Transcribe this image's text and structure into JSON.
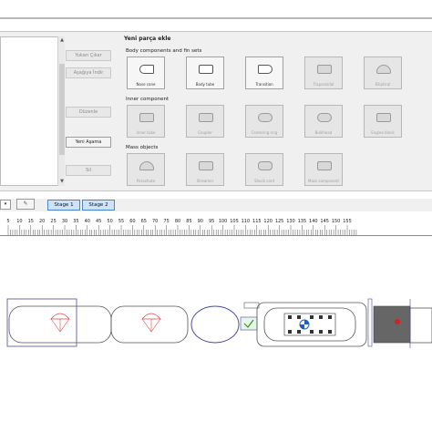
{
  "side_buttons": [
    {
      "label": "Yukarı Çıkar",
      "active": false
    },
    {
      "label": "Aşağıya İndir",
      "active": false
    },
    {
      "label": "Düzenle",
      "active": false
    },
    {
      "label": "Yeni Aşama",
      "active": true
    },
    {
      "label": "Sil",
      "active": false
    }
  ],
  "parts_panel": {
    "title": "Yeni parça ekle",
    "sections": [
      {
        "label": "Body components and fin sets",
        "tiles": [
          {
            "label": "Nose cone",
            "icon": "nose-cone-icon",
            "enabled": true
          },
          {
            "label": "Body tube",
            "icon": "body-tube-icon",
            "enabled": true
          },
          {
            "label": "Transition",
            "icon": "transition-icon",
            "enabled": true
          },
          {
            "label": "Trapezoidal",
            "icon": "trapezoidal-fin-icon",
            "enabled": false
          },
          {
            "label": "Elliptical",
            "icon": "elliptical-fin-icon",
            "enabled": false
          }
        ]
      },
      {
        "label": "Inner component",
        "tiles": [
          {
            "label": "Inner tube",
            "icon": "inner-tube-icon",
            "enabled": false
          },
          {
            "label": "Coupler",
            "icon": "coupler-icon",
            "enabled": false
          },
          {
            "label": "Centering ring",
            "icon": "centering-ring-icon",
            "enabled": false
          },
          {
            "label": "Bulkhead",
            "icon": "bulkhead-icon",
            "enabled": false
          },
          {
            "label": "Engine block",
            "icon": "engine-block-icon",
            "enabled": false
          }
        ]
      },
      {
        "label": "Mass objects",
        "tiles": [
          {
            "label": "Parachute",
            "icon": "parachute-icon",
            "enabled": false
          },
          {
            "label": "Streamer",
            "icon": "streamer-icon",
            "enabled": false
          },
          {
            "label": "Shock cord",
            "icon": "shock-cord-icon",
            "enabled": false
          },
          {
            "label": "Mass component",
            "icon": "mass-component-icon",
            "enabled": false
          }
        ]
      }
    ]
  },
  "stages": [
    {
      "label": "Stage 1"
    },
    {
      "label": "Stage 2"
    }
  ],
  "stage_dropdown_glyph": "▾",
  "tool_glyph": "✎",
  "ruler": {
    "labels": [
      "5",
      "10",
      "15",
      "20",
      "25",
      "30",
      "35",
      "40",
      "45",
      "50",
      "55",
      "60",
      "65",
      "70",
      "75",
      "80",
      "85",
      "90",
      "95",
      "100",
      "105",
      "110",
      "115",
      "120",
      "125",
      "130",
      "135",
      "140",
      "145",
      "150",
      "155"
    ]
  },
  "colors": {
    "stage_tab_fill": "#cfe3f8",
    "stage_tab_border": "#4a86c8",
    "rocket_outline": "#4a4aa0",
    "parachute": "#d94a4a",
    "motor_mount": "#666666",
    "cg_marker": "#d91e1e",
    "pressure_marker": "#1f5fbf"
  }
}
